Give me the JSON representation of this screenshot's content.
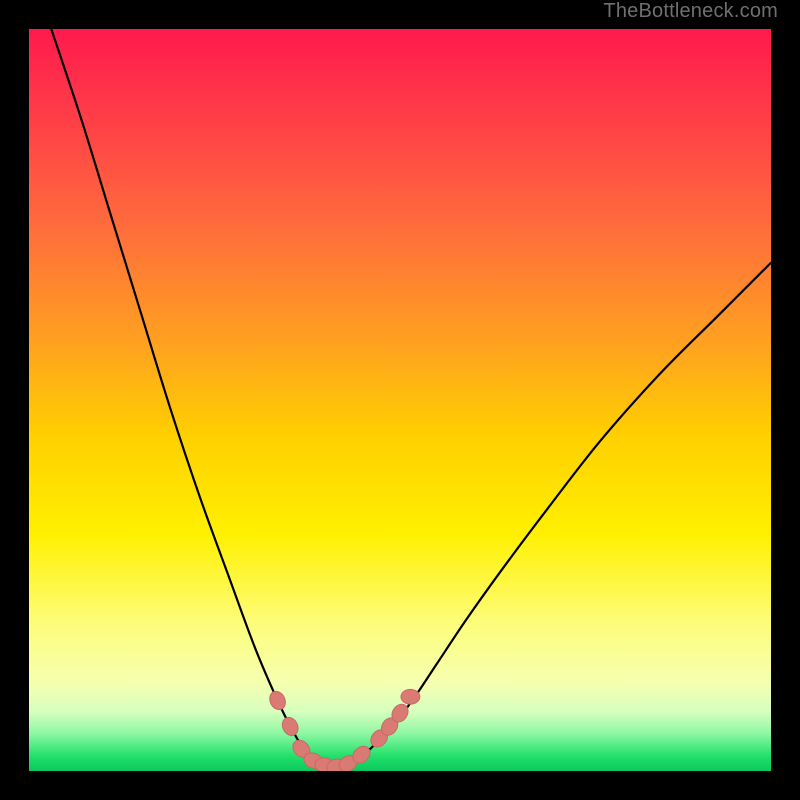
{
  "watermark": "TheBottleneck.com",
  "colors": {
    "frame": "#000000",
    "curve": "#000000",
    "marker_fill": "#d97b74",
    "marker_stroke": "#c86a64",
    "gradient_stops": [
      "#ff1a4d",
      "#ff3e47",
      "#ff6a3d",
      "#ffa020",
      "#ffd000",
      "#fff000",
      "#fdfd7a",
      "#f6ffae",
      "#d7ffbf",
      "#8cf7a2",
      "#22e06a",
      "#0cc85e"
    ]
  },
  "chart_data": {
    "type": "line",
    "title": "",
    "xlabel": "",
    "ylabel": "",
    "xlim": [
      0,
      1
    ],
    "ylim": [
      0,
      1
    ],
    "axes_visible": false,
    "note": "Axes and units are not shown in the image; values are normalized estimates in [0,1] where y≈1 means the curve is near the top edge and y≈0 near the bottom.",
    "series": [
      {
        "name": "curve",
        "x": [
          0.03,
          0.07,
          0.11,
          0.15,
          0.19,
          0.23,
          0.27,
          0.305,
          0.335,
          0.355,
          0.37,
          0.385,
          0.4,
          0.415,
          0.435,
          0.46,
          0.49,
          0.52,
          0.55,
          0.59,
          0.64,
          0.7,
          0.77,
          0.85,
          0.93,
          1.0
        ],
        "y": [
          1.0,
          0.88,
          0.75,
          0.62,
          0.49,
          0.37,
          0.26,
          0.165,
          0.095,
          0.055,
          0.03,
          0.012,
          0.005,
          0.005,
          0.012,
          0.03,
          0.06,
          0.1,
          0.145,
          0.205,
          0.275,
          0.355,
          0.445,
          0.535,
          0.615,
          0.685
        ]
      }
    ],
    "markers": {
      "name": "dots_near_valley",
      "shape": "rounded-capsule",
      "approx_pixel_radius": 9,
      "points": [
        {
          "x": 0.335,
          "y": 0.095
        },
        {
          "x": 0.352,
          "y": 0.06
        },
        {
          "x": 0.367,
          "y": 0.03
        },
        {
          "x": 0.383,
          "y": 0.014
        },
        {
          "x": 0.398,
          "y": 0.008
        },
        {
          "x": 0.414,
          "y": 0.006
        },
        {
          "x": 0.43,
          "y": 0.01
        },
        {
          "x": 0.448,
          "y": 0.022
        },
        {
          "x": 0.472,
          "y": 0.044
        },
        {
          "x": 0.486,
          "y": 0.06
        },
        {
          "x": 0.5,
          "y": 0.078
        },
        {
          "x": 0.514,
          "y": 0.1
        }
      ]
    }
  }
}
